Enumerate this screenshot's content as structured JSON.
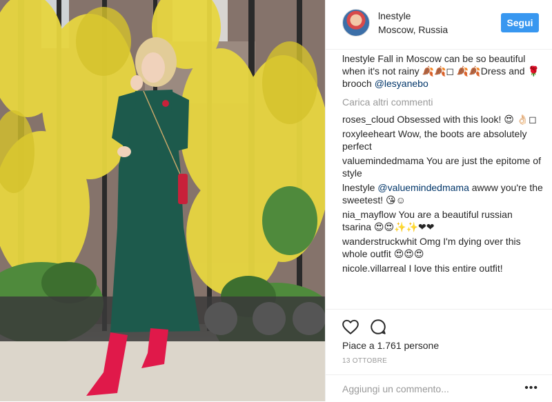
{
  "post": {
    "username": "lnestyle",
    "location": "Moscow, Russia",
    "follow_label": "Segui",
    "caption": {
      "username": "lnestyle",
      "text_before": " Fall in Moscow can be so beautiful when it's not rainy 🍂🍂◻ 🍂🍂Dress and 🌹 brooch ",
      "mention": "@lesyanebo"
    },
    "load_more_label": "Carica altri commenti",
    "comments": [
      {
        "username": "roses_cloud",
        "text": " Obsessed with this look! 😍 👌🏻◻"
      },
      {
        "username": "roxyleeheart",
        "text": " Wow, the boots are absolutely perfect"
      },
      {
        "username": "valuemindedmama",
        "text": " You are just the epitome of style"
      },
      {
        "username": "lnestyle",
        "mention": " @valuemindedmama",
        "text": " awww you're the sweetest! 😘☺"
      },
      {
        "username": "nia_mayflow",
        "text": " You are a beautiful russian tsarina 😍😍✨✨❤❤"
      },
      {
        "username": "wanderstruckwhit",
        "text": " Omg I'm dying over this whole outfit 😍😍😍"
      },
      {
        "username": "nicole.villarreal",
        "text": " I love this entire outfit!"
      }
    ],
    "likes_label": "Piace a 1.761 persone",
    "date_label": "13 OTTOBRE",
    "comment_placeholder": "Aggiungi un commento...",
    "more_label": "•••",
    "icons": {
      "like": "heart-icon",
      "comment": "speech-bubble-icon",
      "more": "more-options-icon"
    },
    "colors": {
      "follow_button": "#3897f0",
      "mention": "#003569",
      "muted": "#999999",
      "dress": "#1d5a4c",
      "boots": "#e0194a",
      "foliage": "#e7d640"
    }
  }
}
